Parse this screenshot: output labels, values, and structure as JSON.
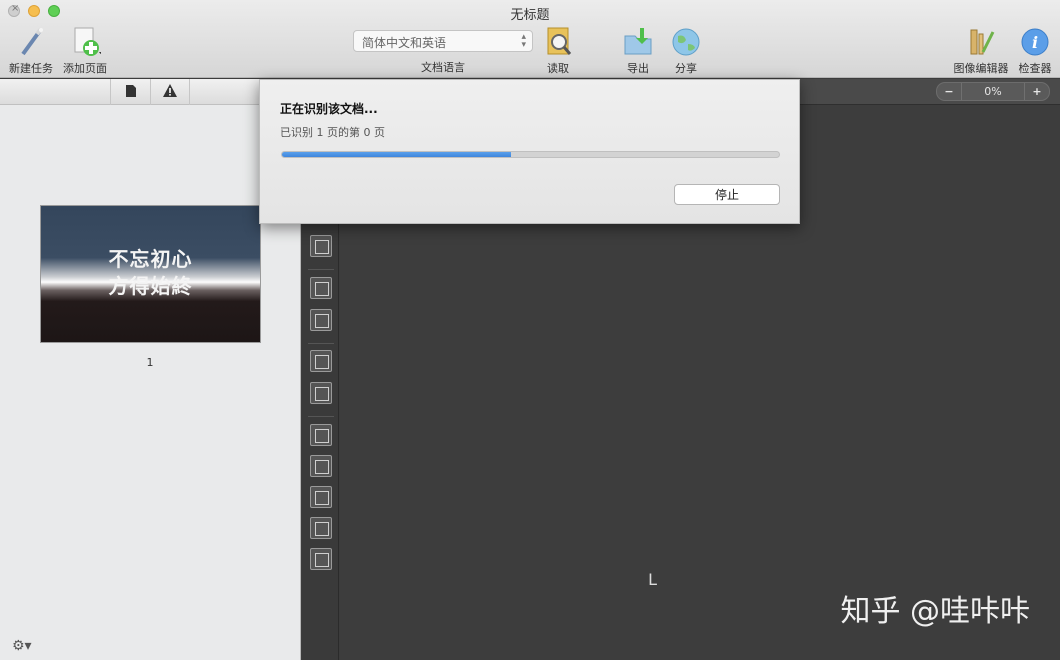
{
  "window": {
    "title": "无标题"
  },
  "toolbar": {
    "new_task": "新建任务",
    "add_page": "添加页面",
    "language_value": "简体中文和英语",
    "language_caption": "文档语言",
    "read": "读取",
    "export": "导出",
    "share": "分享",
    "image_editor": "图像编辑器",
    "inspector": "检查器"
  },
  "sidebar": {
    "thumbnail_line1": "不忘初心",
    "thumbnail_line2": "方得始終",
    "page_number": "1"
  },
  "zoom": {
    "minus": "−",
    "value": "0%",
    "plus": "+"
  },
  "dialog": {
    "title": "正在识别该文档...",
    "status": "已识别 1 页的第 0 页",
    "progress": 0.46,
    "stop_label": "停止"
  },
  "watermark": {
    "text": "知乎 @哇咔咔"
  },
  "canvas": {
    "marker": "L"
  },
  "colors": {
    "progress": "#3f86dc",
    "canvas": "#3d3d3d",
    "sidebar": "#e9eaeb"
  }
}
